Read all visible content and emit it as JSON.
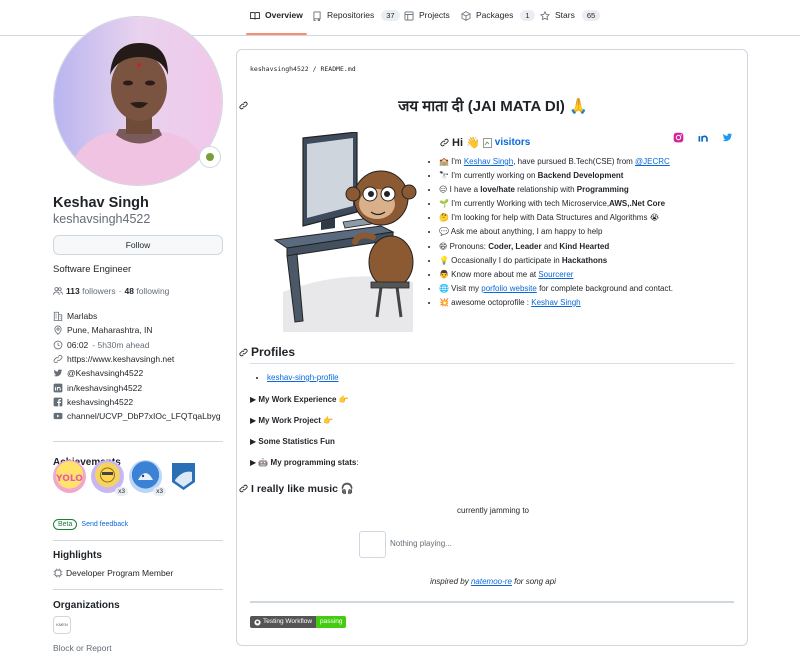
{
  "tabs": [
    {
      "label": "Overview",
      "count": null,
      "icon": "book-icon"
    },
    {
      "label": "Repositories",
      "count": "37",
      "icon": "repo-icon"
    },
    {
      "label": "Projects",
      "count": null,
      "icon": "table-icon"
    },
    {
      "label": "Packages",
      "count": "1",
      "icon": "package-icon"
    },
    {
      "label": "Stars",
      "count": "65",
      "icon": "star-icon"
    }
  ],
  "profile": {
    "full_name": "Keshav Singh",
    "username": "keshavsingh4522",
    "follow_label": "Follow",
    "bio": "Software Engineer",
    "followers_count": "113",
    "followers_label": "followers",
    "separator": "·",
    "following_count": "48",
    "following_label": "following",
    "details": [
      {
        "icon": "organization-icon",
        "text": "Marlabs"
      },
      {
        "icon": "location-icon",
        "text": "Pune, Maharashtra, IN"
      },
      {
        "icon": "clock-icon",
        "text": "06:02",
        "muted": "- 5h30m ahead"
      },
      {
        "icon": "link-icon",
        "text": "https://www.keshavsingh.net"
      },
      {
        "icon": "twitter-icon",
        "text": "@Keshavsingh4522"
      },
      {
        "icon": "linkedin-icon",
        "text": "in/keshavsingh4522"
      },
      {
        "icon": "facebook-icon",
        "text": "keshavsingh4522"
      },
      {
        "icon": "youtube-icon",
        "text": "channel/UCVP_DbP7xIOc_LFQTqaLbyg"
      }
    ],
    "achievements_title": "Achievements",
    "achievement_counts": [
      "",
      "x3",
      "x3",
      ""
    ],
    "beta_label": "Beta",
    "feedback_label": "Send feedback",
    "highlights_title": "Highlights",
    "highlight_item": "Developer Program Member",
    "organizations_title": "Organizations",
    "org_logo_text": "KMEN",
    "block_label": "Block or Report"
  },
  "readme": {
    "path_user": "keshavsingh4522",
    "path_sep": " / ",
    "path_file": "README.md",
    "heading": "जय माता दी (JAI MATA DI) 🙏",
    "hi_label": "Hi 👋",
    "visitors_alt": "visitors",
    "list": {
      "l0a": "🏫 I'm ",
      "l0b": "Keshav Singh",
      "l0c": ", have pursued B.Tech(CSE) from ",
      "l0d": "@JECRC",
      "l1a": "🔭 I'm currently working on ",
      "l1b": "Backend Development",
      "l2a": "😑 I have a ",
      "l2b": "love/hate",
      "l2c": " relationship with ",
      "l2d": "Programming",
      "l3a": "🌱 I'm currently Working with tech Microservice,",
      "l3b": "AWS,.Net Core",
      "l4a": "🤔 I'm looking for help with Data Structures and Algorithms 😭",
      "l5a": "💬 Ask me about anything, I am happy to help",
      "l6a": "😄 Pronouns: ",
      "l6b": "Coder, Leader",
      "l6c": " and ",
      "l6d": "Kind Hearted",
      "l7a": "💡 Occasionally I do participate in ",
      "l7b": "Hackathons",
      "l8a": "👨 Know more about me at ",
      "l8b": "Sourcerer",
      "l9a": "🌐 Visit my ",
      "l9b": "porfolio website",
      "l9c": " for complete background and contact.",
      "l10a": "💥 awesome octoprofile : ",
      "l10b": "Keshav Singh"
    },
    "profiles_heading": "Profiles",
    "profile_link": "keshav-singh-profile",
    "work_experience": "My Work Experience 👉",
    "work_project": "My Work Project 👉",
    "stats_fun": "Some Statistics Fun",
    "prog_stats_a": "🤖 My programming stats",
    "prog_stats_b": ":",
    "music_heading": "I really like music 🎧",
    "jamming": "currently jamming to",
    "nothing_playing": "Nothing playing...",
    "inspired_a": "inspired by ",
    "inspired_b": "natemoo-re",
    "inspired_c": " for song api",
    "workflow_label": "Testing Workflow",
    "workflow_status": "passing"
  },
  "colors": {
    "accent": "#0969da",
    "tab_underline": "#fd8c73",
    "beta": "#1a7f37",
    "passing": "#44cc11"
  }
}
